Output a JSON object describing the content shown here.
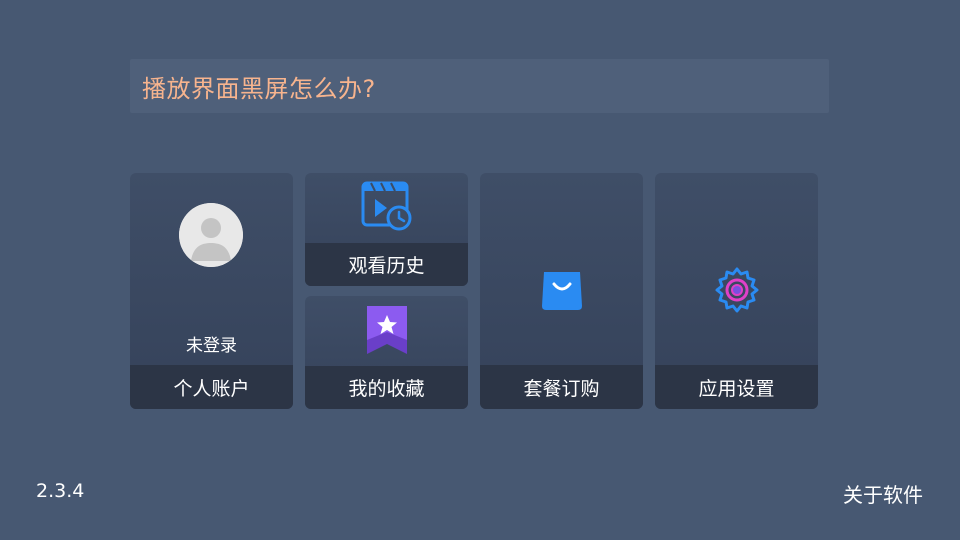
{
  "banner": {
    "text": "播放界面黑屏怎么办?"
  },
  "tiles": {
    "account": {
      "status": "未登录",
      "label": "个人账户",
      "icon": "avatar-icon"
    },
    "history": {
      "label": "观看历史",
      "icon": "history-icon"
    },
    "favorites": {
      "label": "我的收藏",
      "icon": "favorite-star-icon"
    },
    "packages": {
      "label": "套餐订购",
      "icon": "shopping-bag-icon"
    },
    "settings": {
      "label": "应用设置",
      "icon": "settings-gear-icon"
    }
  },
  "footer": {
    "version": "2.3.4",
    "about": "关于软件"
  },
  "colors": {
    "background": "#475872",
    "banner_text": "#f7b48e",
    "icon_blue": "#2a8bf2",
    "icon_purple": "#7a4fe0",
    "icon_magenta": "#e040c8"
  }
}
